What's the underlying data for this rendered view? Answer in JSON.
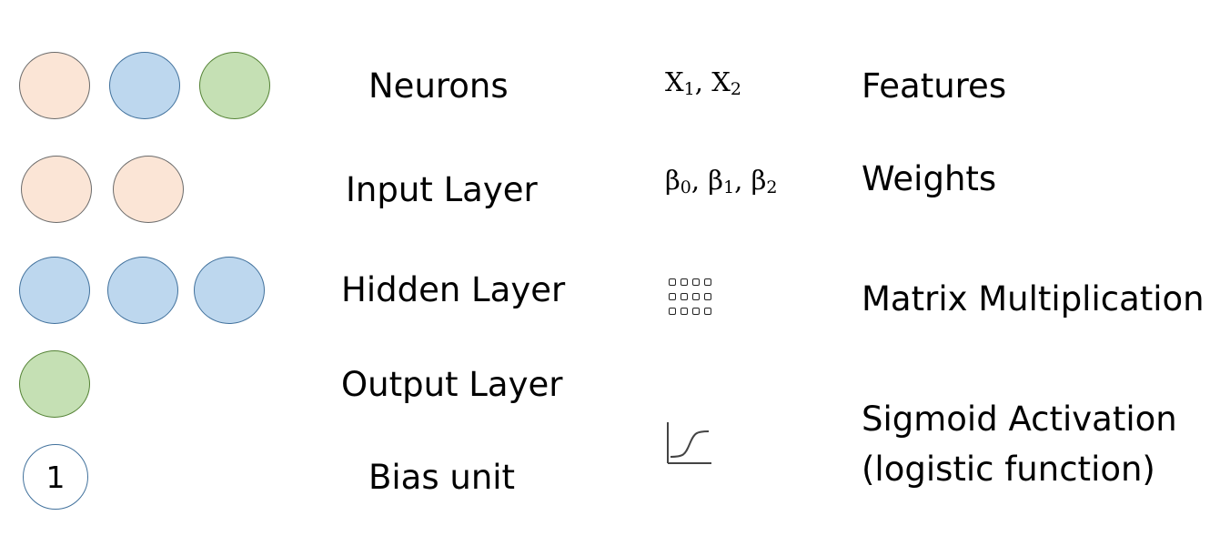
{
  "left_labels": {
    "neurons": "Neurons",
    "input_layer": "Input Layer",
    "hidden_layer": "Hidden Layer",
    "output_layer": "Output Layer",
    "bias_unit": "Bias unit"
  },
  "bias_value": "1",
  "features": {
    "symbol": "X",
    "sub1": "1",
    "sub2": "2",
    "label": "Features"
  },
  "weights": {
    "symbol": "β",
    "sub0": "0",
    "sub1": "1",
    "sub2": "2",
    "label": "Weights"
  },
  "matrix": {
    "label": "Matrix Multiplication",
    "icon": "matrix-dots-icon"
  },
  "sigmoid": {
    "label_line1": "Sigmoid Activation",
    "label_line2": "(logistic function)",
    "icon": "sigmoid-curve-icon"
  },
  "colors": {
    "input": "#fbe5d6",
    "hidden": "#bdd7ee",
    "output": "#c5e0b4"
  }
}
